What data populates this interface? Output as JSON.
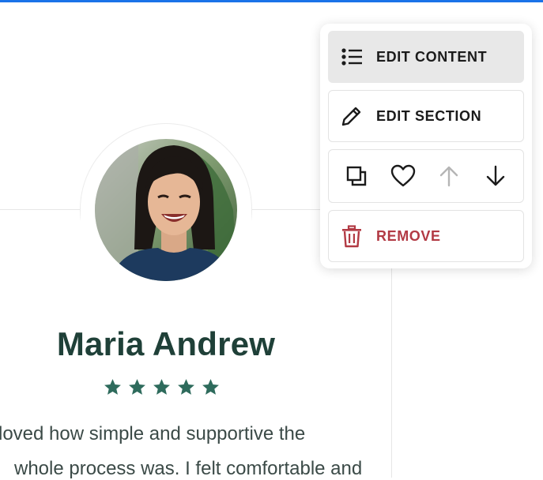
{
  "menu": {
    "edit_content_label": "EDIT CONTENT",
    "edit_section_label": "EDIT SECTION",
    "remove_label": "REMOVE",
    "actions": [
      {
        "icon": "duplicate-icon"
      },
      {
        "icon": "heart-icon"
      },
      {
        "icon": "arrow-up-icon",
        "state": "disabled"
      },
      {
        "icon": "arrow-down-icon"
      }
    ]
  },
  "testimonial": {
    "name": "Maria Andrew",
    "rating": 5,
    "rating_max": 5,
    "text_line1": "loved how simple and supportive the",
    "text_line2": "whole process was. I felt comfortable and"
  },
  "colors": {
    "accent_bar": "#1a73e8",
    "name_color": "#1f4038",
    "star_color": "#2e6b5c",
    "danger": "#b23a44",
    "disabled_icon": "#b5b5b5"
  }
}
